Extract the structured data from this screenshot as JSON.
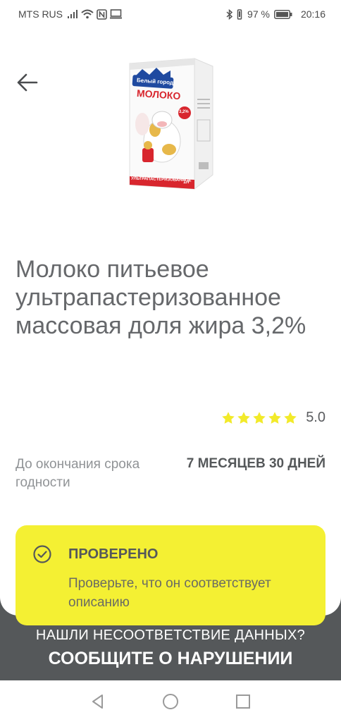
{
  "status_bar": {
    "carrier": "MTS RUS",
    "battery": "97 %",
    "time": "20:16",
    "icons": [
      "signal-icon",
      "wifi-icon",
      "nfc-icon",
      "screen-icon",
      "bluetooth-icon",
      "vibrate-icon",
      "battery-icon"
    ]
  },
  "product": {
    "title": "Молоко питьевое ультрапастеризованное массовая доля жира 3,2%",
    "image": {
      "brand": "Белый город",
      "name": "МОЛОКО",
      "fat": "3,2%",
      "type": "УЛЬТРАПАСТЕРИЗОВАННОЕ",
      "volume": "1л"
    },
    "rating": {
      "stars": 5,
      "value": "5.0",
      "star_color": "#f2ea2a"
    },
    "expiry": {
      "label": "До окончания срока годности",
      "value": "7 МЕСЯЦЕВ 30 ДНЕЙ"
    }
  },
  "verification": {
    "title": "ПРОВЕРЕНО",
    "description": "Проверьте, что он соответствует описанию",
    "background": "#f4f033"
  },
  "report": {
    "question": "НАШЛИ НЕСООТВЕТСТВИЕ ДАННЫХ?",
    "action": "СООБЩИТЕ О НАРУШЕНИИ"
  },
  "nav": {
    "back_icon": "back-arrow-icon",
    "system_buttons": [
      "back-triangle-icon",
      "home-circle-icon",
      "recents-square-icon"
    ]
  }
}
